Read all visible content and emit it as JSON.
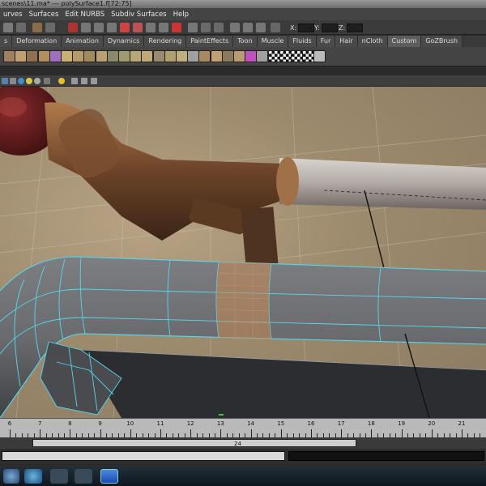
{
  "window": {
    "title": "scenes\\11.ma*  ---  polySurface1.f[72:75]"
  },
  "menubar": {
    "items": [
      "urves",
      "Surfaces",
      "Edit NURBS",
      "Subdiv Surfaces",
      "Help"
    ]
  },
  "statusline": {
    "x_label": "X:",
    "y_label": "Y:",
    "z_label": "Z:"
  },
  "shelf": {
    "tabs": [
      "s",
      "Deformation",
      "Animation",
      "Dynamics",
      "Rendering",
      "PaintEffects",
      "Toon",
      "Muscle",
      "Fluids",
      "Fur",
      "Hair",
      "nCloth",
      "Custom",
      "GoZBrush"
    ],
    "active_tab": "Custom",
    "icons": [
      "deform-icon",
      "wire-icon",
      "lattice-icon",
      "cluster-icon",
      "cube-icon",
      "plane-icon",
      "bend-icon",
      "twist-icon",
      "flare-icon",
      "sine-icon",
      "squash-icon",
      "wave-icon",
      "sculpt-icon",
      "wrap-icon",
      "shrink-icon",
      "blend-icon",
      "bone-icon",
      "ik-icon",
      "skin-icon",
      "paint-weights-icon",
      "soft-mod-icon",
      "triangle-icon",
      "cloth-icon",
      "checker-icon",
      "checker-icon",
      "checker-icon",
      "checker-icon",
      "select-icon"
    ]
  },
  "viewport": {
    "wireframe_color": "#55d8f0",
    "selected_face_color": "#c98a54",
    "pipe_color": "#6d6e71"
  },
  "timeslider": {
    "ticks": [
      "6",
      "7",
      "8",
      "9",
      "10",
      "11",
      "12",
      "13",
      "14",
      "15",
      "16",
      "17",
      "18",
      "19",
      "20",
      "21"
    ],
    "current_frame": "24"
  },
  "colors": {
    "accent": "#4fc3e8",
    "maya_bg": "#444444"
  }
}
